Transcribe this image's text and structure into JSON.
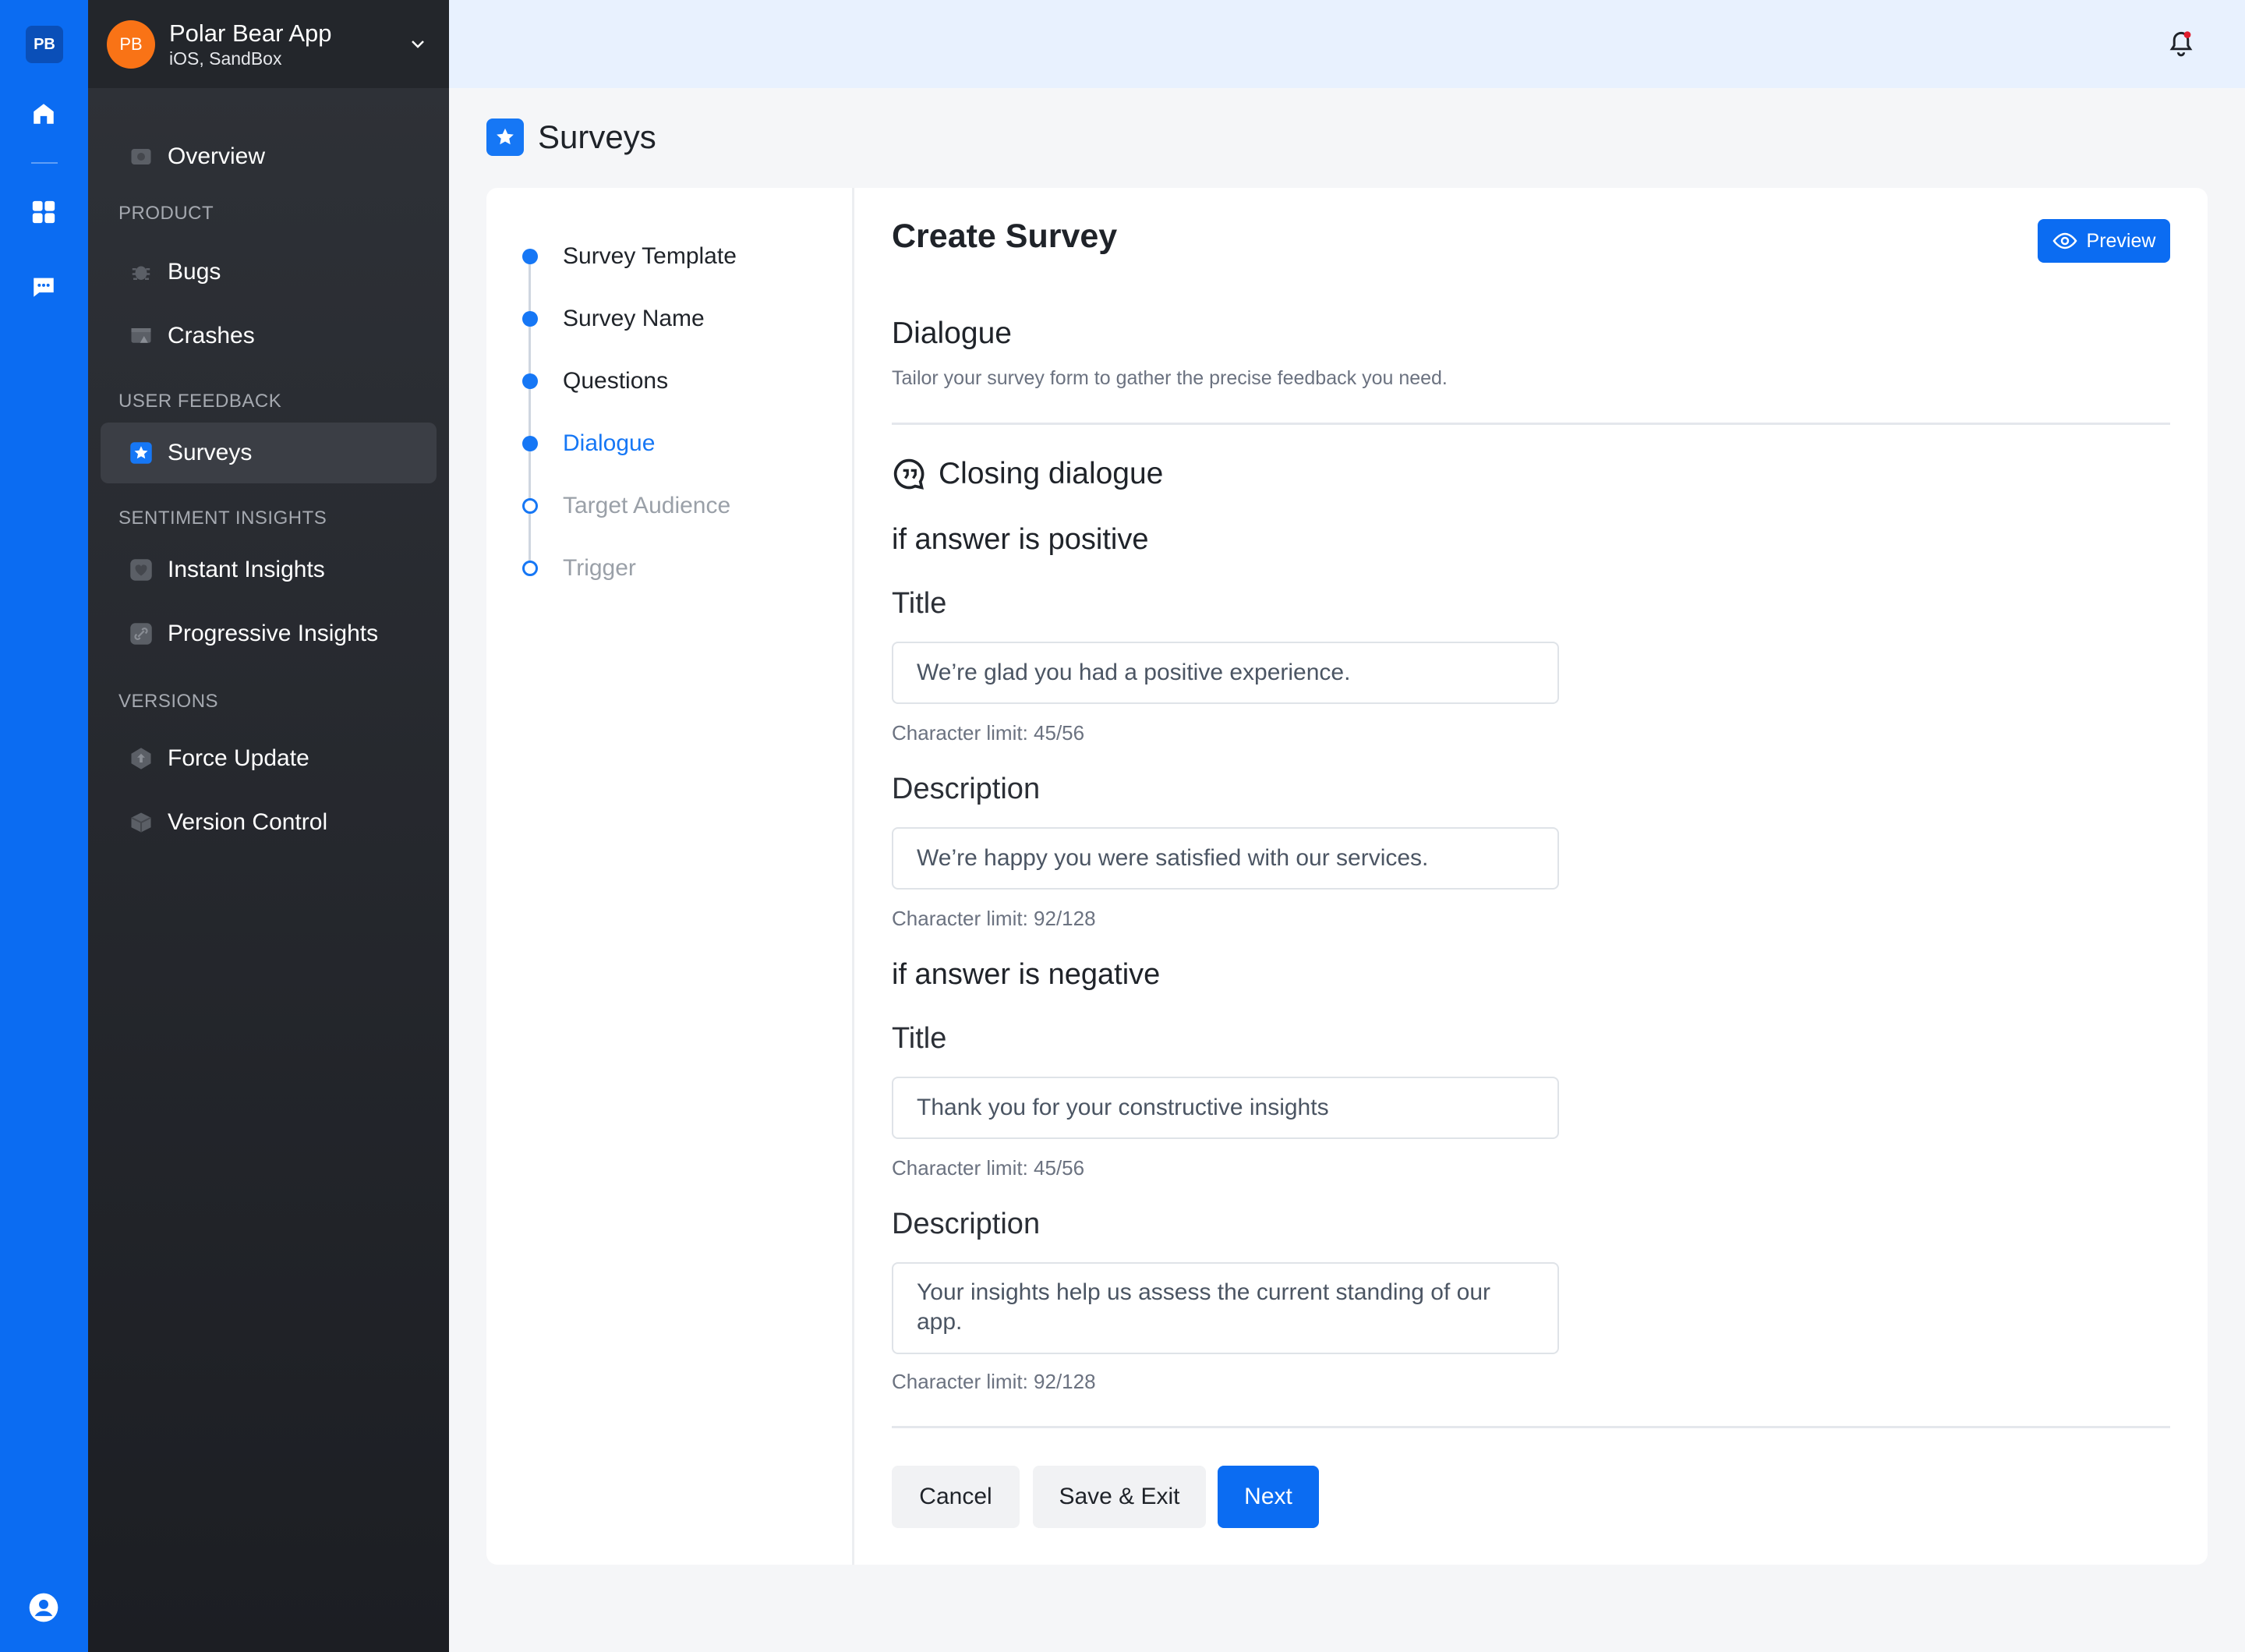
{
  "rail": {
    "logo": "PB",
    "icons": [
      "home-icon",
      "grid-icon",
      "chat-icon",
      "user-icon"
    ]
  },
  "app": {
    "avatar": "PB",
    "name": "Polar Bear App",
    "platform": "iOS, SandBox"
  },
  "sidebar": {
    "overview": "Overview",
    "sections": {
      "product": "PRODUCT",
      "user_feedback": "USER FEEDBACK",
      "sentiment": "SENTIMENT INSIGHTS",
      "versions": "VERSIONS"
    },
    "items": {
      "bugs": "Bugs",
      "crashes": "Crashes",
      "surveys": "Surveys",
      "instant": "Instant Insights",
      "progressive": "Progressive Insights",
      "force_update": "Force Update",
      "version_control": "Version Control"
    }
  },
  "page": {
    "title": "Surveys"
  },
  "steps": [
    {
      "label": "Survey Template",
      "state": "done"
    },
    {
      "label": "Survey Name",
      "state": "done"
    },
    {
      "label": "Questions",
      "state": "done"
    },
    {
      "label": "Dialogue",
      "state": "current"
    },
    {
      "label": "Target Audience",
      "state": "future"
    },
    {
      "label": "Trigger",
      "state": "future"
    }
  ],
  "form": {
    "heading": "Create Survey",
    "preview_label": "Preview",
    "section_title": "Dialogue",
    "section_subtitle": "Tailor your survey form to gather the precise feedback you need.",
    "closing_title": "Closing dialogue",
    "positive": {
      "heading": "if answer is positive",
      "title_label": "Title",
      "title_value": "We’re glad you had a positive experience.",
      "title_limit": "Character limit: 45/56",
      "desc_label": "Description",
      "desc_value": "We’re happy you were satisfied with our services.",
      "desc_limit": "Character limit: 92/128"
    },
    "negative": {
      "heading": "if answer is negative",
      "title_label": "Title",
      "title_value": "Thank you for your constructive insights",
      "title_limit": "Character limit: 45/56",
      "desc_label": "Description",
      "desc_value": "Your insights help us assess the current standing of our app.",
      "desc_limit": "Character limit: 92/128"
    },
    "buttons": {
      "cancel": "Cancel",
      "save_exit": "Save & Exit",
      "next": "Next"
    }
  },
  "colors": {
    "accent": "#0b6cf2",
    "rail": "#0b6cf2",
    "sidebar": "#23262b",
    "avatar": "#f97316"
  }
}
